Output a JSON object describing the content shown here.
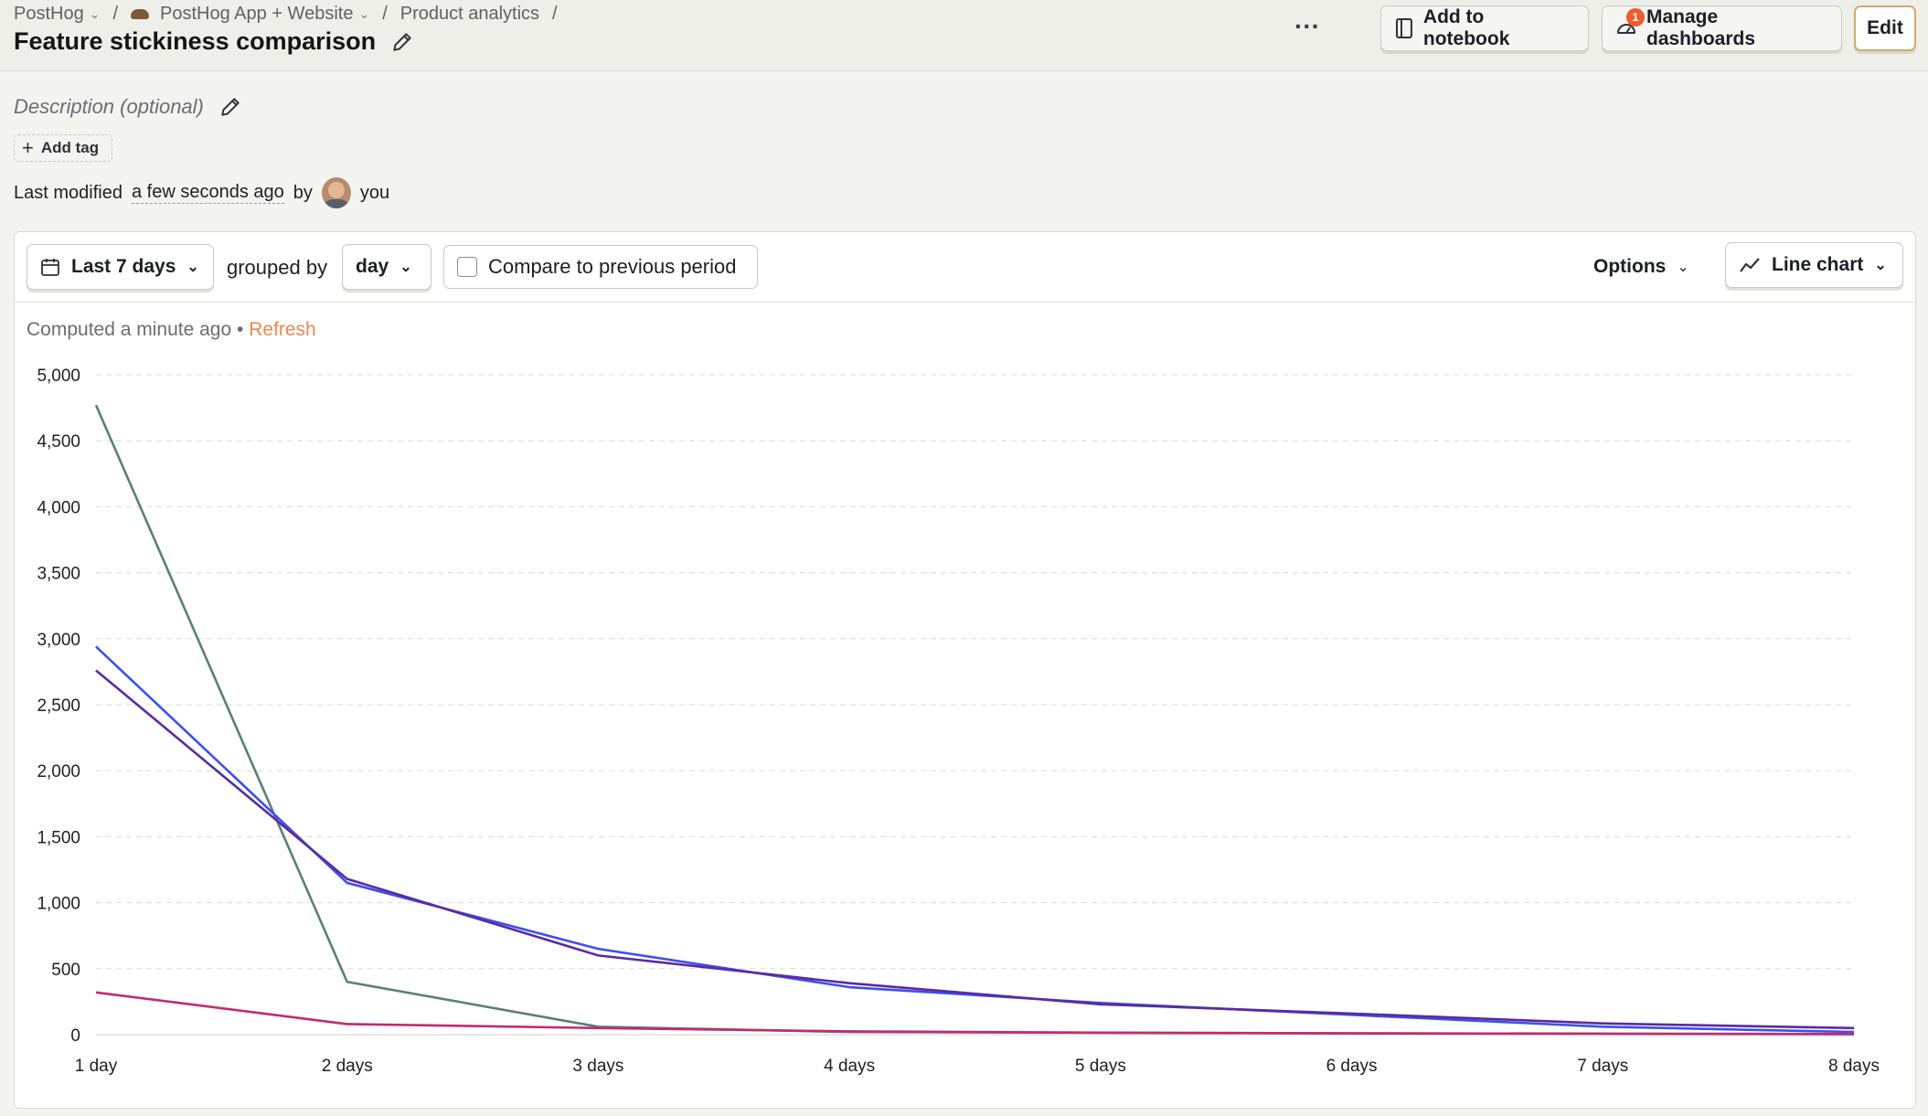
{
  "breadcrumb": {
    "items": [
      "PostHog",
      "PostHog App + Website",
      "Product analytics"
    ],
    "separator": "/"
  },
  "page_title": "Feature stickiness comparison",
  "header_buttons": {
    "more": "···",
    "add_to_notebook": "Add to notebook",
    "manage_dashboards": "Manage dashboards",
    "manage_dashboards_badge": "1",
    "edit": "Edit"
  },
  "description_placeholder": "Description (optional)",
  "add_tag": "Add tag",
  "modified": {
    "prefix": "Last modified",
    "ago": "a few seconds ago",
    "by": "by",
    "user": "you"
  },
  "filters": {
    "date_range": "Last 7 days",
    "grouped_by_label": "grouped by",
    "interval": "day",
    "compare_label": "Compare to previous period",
    "compare_checked": false,
    "options_label": "Options",
    "chart_type_label": "Line chart"
  },
  "computed": {
    "text": "Computed a minute ago",
    "separator": "•",
    "refresh": "Refresh"
  },
  "colors": {
    "accent_orange": "#e88a4f",
    "badge": "#f05b2b"
  },
  "chart_data": {
    "type": "line",
    "categories": [
      "1 day",
      "2 days",
      "3 days",
      "4 days",
      "5 days",
      "6 days",
      "7 days",
      "8 days"
    ],
    "ylim": [
      0,
      5000
    ],
    "yticks": [
      0,
      500,
      1000,
      1500,
      2000,
      2500,
      3000,
      3500,
      4000,
      4500,
      5000
    ],
    "ytick_labels": [
      "0",
      "500",
      "1,000",
      "1,500",
      "2,000",
      "2,500",
      "3,000",
      "3,500",
      "4,000",
      "4,500",
      "5,000"
    ],
    "grid": true,
    "series": [
      {
        "color": "#5a7f78",
        "values": [
          4770,
          400,
          60,
          20,
          15,
          10,
          8,
          5
        ]
      },
      {
        "color": "#3b4ff0",
        "values": [
          2940,
          1150,
          650,
          360,
          240,
          150,
          60,
          20
        ]
      },
      {
        "color": "#5b2a9e",
        "values": [
          2760,
          1180,
          600,
          390,
          230,
          160,
          85,
          50
        ]
      },
      {
        "color": "#c02b72",
        "values": [
          320,
          80,
          50,
          25,
          15,
          10,
          6,
          3
        ]
      }
    ]
  }
}
